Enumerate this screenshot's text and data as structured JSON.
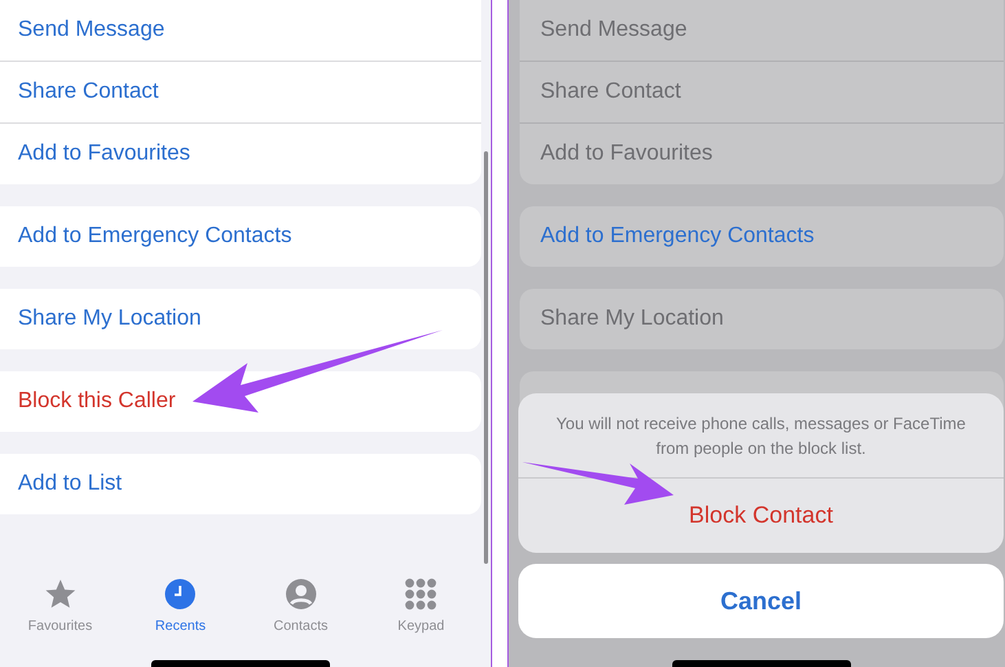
{
  "contact_screen": {
    "groups": [
      {
        "items": [
          {
            "label": "Send Message",
            "kind": "action"
          },
          {
            "label": "Share Contact",
            "kind": "action"
          },
          {
            "label": "Add to Favourites",
            "kind": "action"
          }
        ]
      },
      {
        "items": [
          {
            "label": "Add to Emergency Contacts",
            "kind": "action"
          }
        ]
      },
      {
        "items": [
          {
            "label": "Share My Location",
            "kind": "action"
          }
        ]
      },
      {
        "items": [
          {
            "label": "Block this Caller",
            "kind": "destructive"
          }
        ]
      },
      {
        "items": [
          {
            "label": "Add to List",
            "kind": "action"
          }
        ]
      }
    ],
    "tab_bar": [
      {
        "label": "Favourites",
        "selected": false
      },
      {
        "label": "Recents",
        "selected": true
      },
      {
        "label": "Contacts",
        "selected": false
      },
      {
        "label": "Keypad",
        "selected": false
      }
    ]
  },
  "block_screen": {
    "groups": [
      {
        "items": [
          {
            "label": "Send Message",
            "dimmed": true
          },
          {
            "label": "Share Contact",
            "dimmed": true
          },
          {
            "label": "Add to Favourites",
            "dimmed": true
          }
        ]
      },
      {
        "items": [
          {
            "label": "Add to Emergency Contacts",
            "dimmed": false
          }
        ]
      },
      {
        "items": [
          {
            "label": "Share My Location",
            "dimmed": true
          }
        ]
      }
    ],
    "action_sheet": {
      "message": "You will not receive phone calls, messages or FaceTime from people on the block list.",
      "action": "Block Contact",
      "cancel": "Cancel"
    }
  }
}
